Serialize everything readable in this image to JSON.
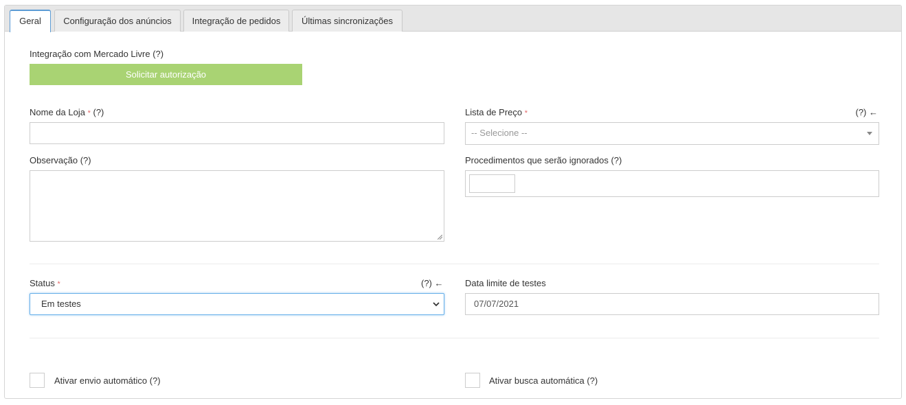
{
  "tabs": [
    {
      "label": "Geral",
      "active": true
    },
    {
      "label": "Configuração dos anúncios",
      "active": false
    },
    {
      "label": "Integração de pedidos",
      "active": false
    },
    {
      "label": "Últimas sincronizações",
      "active": false
    }
  ],
  "integration": {
    "label": "Integração com Mercado Livre (?)",
    "button_label": "Solicitar autorização"
  },
  "store_name": {
    "label": "Nome da Loja",
    "required_mark": "*",
    "help": "(?)",
    "value": ""
  },
  "price_list": {
    "label": "Lista de Preço",
    "required_mark": "*",
    "help": "(?) ←",
    "placeholder": "-- Selecione --"
  },
  "observation": {
    "label": "Observação (?)",
    "value": ""
  },
  "ignored_procedures": {
    "label": "Procedimentos que serão ignorados (?)"
  },
  "status": {
    "label": "Status",
    "required_mark": "*",
    "help": "(?) ←",
    "value": "Em testes"
  },
  "test_deadline": {
    "label": "Data limite de testes",
    "value": "07/07/2021"
  },
  "auto_send": {
    "label": "Ativar envio automático (?)",
    "checked": false
  },
  "auto_fetch": {
    "label": "Ativar busca automática (?)",
    "checked": false
  },
  "colors": {
    "accent": "#5b9bd5",
    "button_green": "#a9d373",
    "required_red": "#e26767"
  }
}
